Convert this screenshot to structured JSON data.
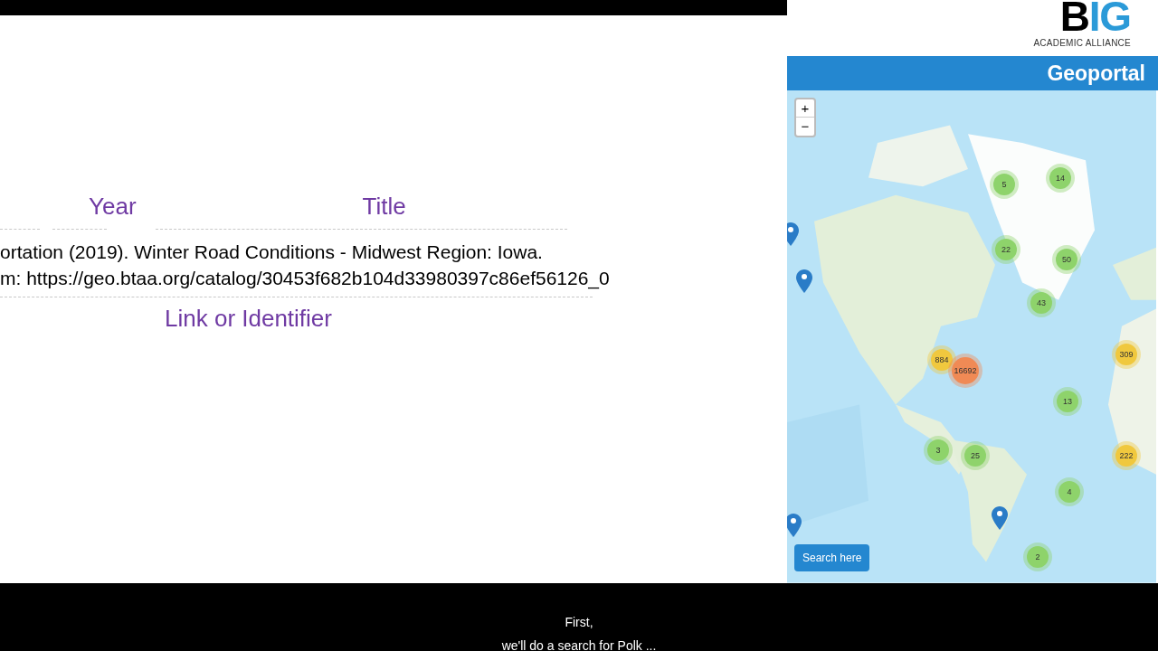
{
  "slide": {
    "year_label": "Year",
    "title_label": "Title",
    "citation_lines": [
      "ortation (2019). Winter Road Conditions - Midwest Region: Iowa.",
      "m: https://geo.btaa.org/catalog/30453f682b104d33980397c86ef56126_0"
    ],
    "link_label": "Link or Identifier"
  },
  "portal": {
    "logo": {
      "big_b": "B",
      "big_ig": "IG",
      "subtitle": "ACADEMIC ALLIANCE"
    },
    "header_title": "Geoportal",
    "map": {
      "zoom_in": "+",
      "zoom_out": "−",
      "search_button": "Search here",
      "clusters": [
        {
          "count": "5",
          "color": "#8ed36b"
        },
        {
          "count": "14",
          "color": "#8ed36b"
        },
        {
          "count": "22",
          "color": "#8ed36b"
        },
        {
          "count": "50",
          "color": "#8ed36b"
        },
        {
          "count": "43",
          "color": "#8ed36b"
        },
        {
          "count": "884",
          "color": "#f0c83e"
        },
        {
          "count": "16692",
          "color": "#f08a55"
        },
        {
          "count": "309",
          "color": "#f0c83e"
        },
        {
          "count": "13",
          "color": "#8ed36b"
        },
        {
          "count": "3",
          "color": "#8ed36b"
        },
        {
          "count": "25",
          "color": "#8ed36b"
        },
        {
          "count": "222",
          "color": "#f0c83e"
        },
        {
          "count": "4",
          "color": "#8ed36b"
        },
        {
          "count": "2",
          "color": "#8ed36b"
        }
      ]
    }
  },
  "caption": [
    "First,",
    "we'll do a search for Polk ..."
  ]
}
